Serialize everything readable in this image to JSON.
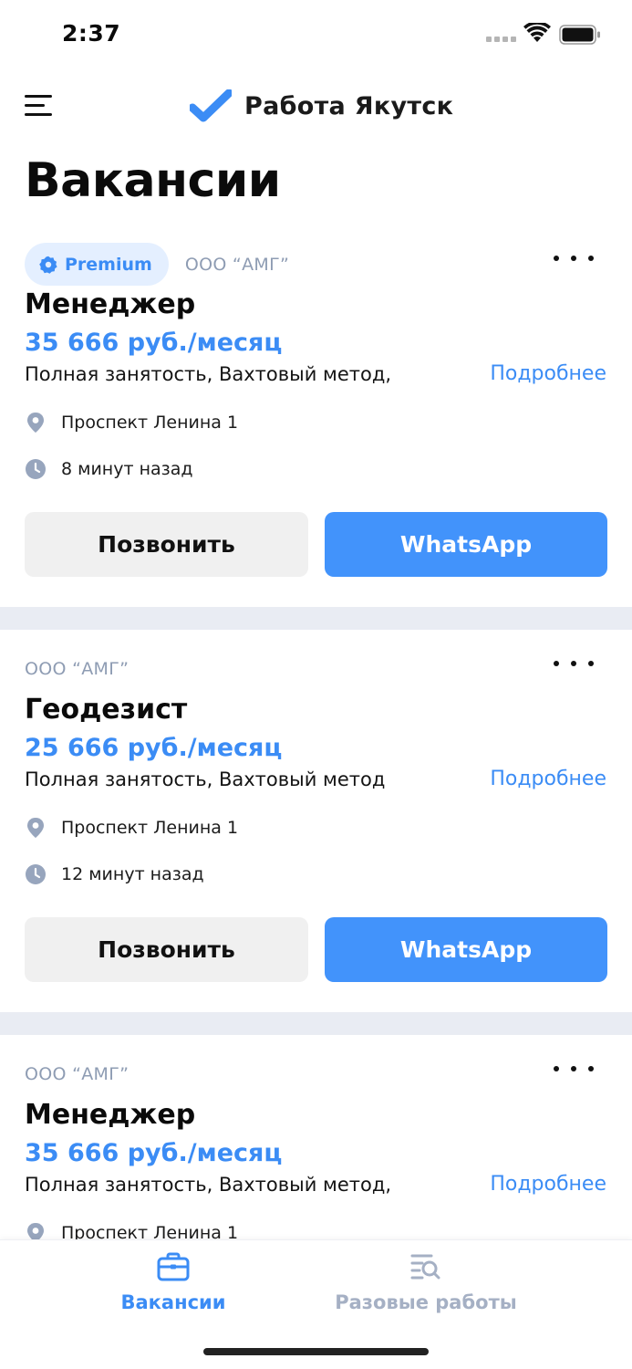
{
  "status_bar": {
    "time": "2:37"
  },
  "header": {
    "app_name": "Работа Якутск"
  },
  "page_title": "Вакансии",
  "jobs": [
    {
      "premium_label": "Premium",
      "company": "ООО “АМГ”",
      "title": "Менеджер",
      "salary": "35 666 руб./месяц",
      "employment": "Полная занятость, Вахтовый метод,",
      "details_label": "Подробнее",
      "address": "Проспект Ленина 1",
      "posted": "8 минут назад",
      "call_label": "Позвонить",
      "whatsapp_label": "WhatsApp"
    },
    {
      "company": "ООО “АМГ”",
      "title": "Геодезист",
      "salary": "25 666 руб./месяц",
      "employment": "Полная занятость, Вахтовый метод",
      "details_label": "Подробнее",
      "address": "Проспект Ленина 1",
      "posted": "12 минут назад",
      "call_label": "Позвонить",
      "whatsapp_label": "WhatsApp"
    },
    {
      "company": "ООО “АМГ”",
      "title": "Менеджер",
      "salary": "35 666 руб./месяц",
      "employment": "Полная занятость, Вахтовый метод,",
      "details_label": "Подробнее",
      "address": "Проспект Ленина 1"
    }
  ],
  "tab_bar": {
    "tabs": [
      {
        "label": "Вакансии",
        "icon": "briefcase-icon",
        "active": true
      },
      {
        "label": "Разовые работы",
        "icon": "list-search-icon",
        "active": false
      }
    ]
  },
  "colors": {
    "accent": "#3b8cf5",
    "whatsapp_button": "#4293fb",
    "muted": "#8e9cb3",
    "separator": "#e9ecf3"
  }
}
